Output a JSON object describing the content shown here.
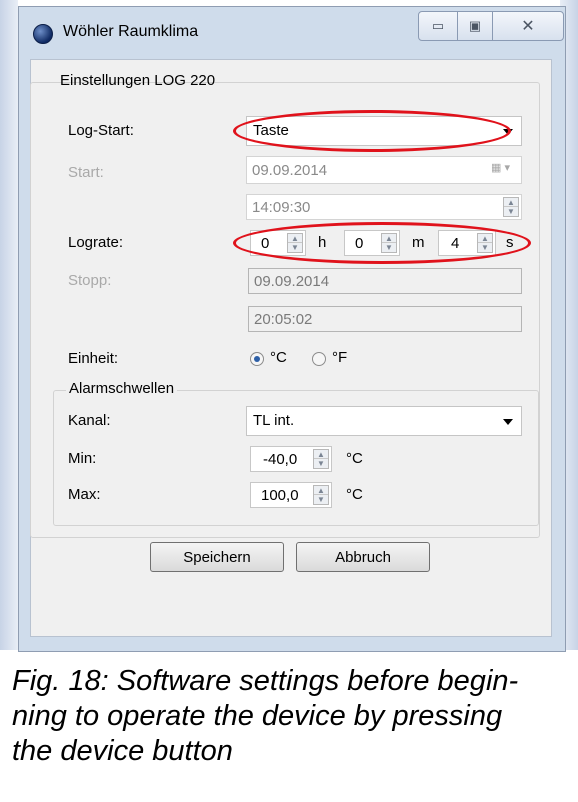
{
  "window": {
    "title": "Wöhler Raumklima",
    "controls": {
      "minimize": "▭",
      "maximize": "▣",
      "close": "✕"
    }
  },
  "group": {
    "title": "Einstellungen LOG 220"
  },
  "log_start": {
    "label": "Log-Start:",
    "value": "Taste"
  },
  "start": {
    "label": "Start:",
    "date": "09.09.2014",
    "time": "14:09:30"
  },
  "lograte": {
    "label": "Lograte:",
    "h_value": "0",
    "h_unit": "h",
    "m_value": "0",
    "m_unit": "m",
    "s_value": "4",
    "s_unit": "s"
  },
  "stopp": {
    "label": "Stopp:",
    "date": "09.09.2014",
    "time": "20:05:02"
  },
  "einheit": {
    "label": "Einheit:",
    "option_c": "°C",
    "option_f": "°F",
    "selected": "°C"
  },
  "alarm": {
    "title": "Alarmschwellen",
    "kanal_label": "Kanal:",
    "kanal_value": "TL int.",
    "min_label": "Min:",
    "min_value": "-40,0",
    "min_unit": "°C",
    "max_label": "Max:",
    "max_value": "100,0",
    "max_unit": "°C"
  },
  "buttons": {
    "save": "Speichern",
    "cancel": "Abbruch"
  },
  "caption": "Fig. 18: Software settings before begin-ning to operate the device by pressing the device button",
  "caption_lines": [
    "Fig. 18: Software settings before begin-",
    "ning to operate the device by pressing",
    "the device button"
  ],
  "highlight_color": "#e0121b"
}
